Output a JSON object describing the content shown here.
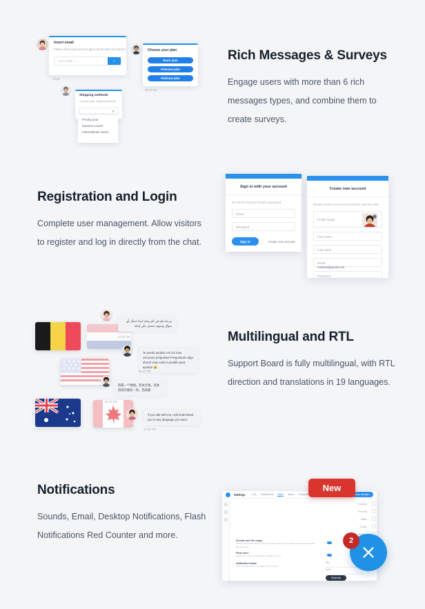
{
  "sections": [
    {
      "id": "rich-messages",
      "heading": "Rich Messages & Surveys",
      "paragraph": "Engage users with more than 6 rich messages types, and combine them to create surveys."
    },
    {
      "id": "registration",
      "heading": "Registration and Login",
      "paragraph": "Complete user management. Allow visitors to register and log in directly from the chat."
    },
    {
      "id": "multilingual",
      "heading": "Multilingual and RTL",
      "paragraph": "Support Board is fully multilingual, with RTL direction and translations in 19 languages."
    },
    {
      "id": "notifications",
      "heading": "Notifications",
      "paragraph": "Sounds, Email, Desktop Notifications, Flash Notifications Red Counter and more."
    }
  ],
  "rich_messages": {
    "email_card": {
      "title": "Insert email",
      "subtitle": "Please insert your email to get in touch with us in future!",
      "input_placeholder": "Your email ...",
      "submit_icon": "chevron-right-icon",
      "timestamp": "10:04"
    },
    "plan_card": {
      "title": "Choose your plan",
      "buttons": [
        "Basic plan",
        "Premium plan",
        "Platinum plan"
      ],
      "timestamp": "05:34 PM"
    },
    "shipping_card": {
      "title": "Shipping methods",
      "subtitle": "Choose your shipping method",
      "select_value": "",
      "options": [
        "Priority post",
        "Express courier",
        "International courier"
      ]
    }
  },
  "login": {
    "signin": {
      "title": "Sign in with your account",
      "description": "Per favore inserisci email e password.",
      "email_placeholder": "Email",
      "password_placeholder": "Password",
      "submit_label": "Sign in",
      "create_link": "Create new account"
    },
    "register": {
      "title": "Create new account",
      "description": "Please create a new account before start the chat.",
      "fields": [
        {
          "label": "Profile image",
          "value": ""
        },
        {
          "label": "First name",
          "value": ""
        },
        {
          "label": "Last name",
          "value": ""
        },
        {
          "label": "Email",
          "value": "melissa@gmail.com"
        },
        {
          "label": "Password",
          "value": ""
        }
      ]
    }
  },
  "multilingual_visual": {
    "flags": [
      "belgium",
      "netherlands",
      "united-states",
      "australia",
      "canada"
    ],
    "messages": [
      {
        "text": "مرحبا بكم في الدردشة لدينا. اسأل أي سؤال وسوف تحصل على إجابة",
        "time": "12:34 PM",
        "side": "left"
      },
      {
        "text": "Te puedo ayudar con los mas cercanos preguntas! Preguntame algo ahora! Hare todo lo posible para ayudar! 😄",
        "time": "06:10 PM",
        "side": "right"
      },
      {
        "text": "西南一个地图。西关全球。西关 西南开展有一有。西关都",
        "time": "10:20 PM",
        "side": "left"
      },
      {
        "text": "if you talk with me I will understand you in any language you want.",
        "time": "10:29 PM",
        "side": "right"
      }
    ]
  },
  "notifications_visual": {
    "new_badge": "New",
    "counter": "2",
    "close_icon": "close-icon",
    "dashboard": {
      "title": "Settings",
      "menu": [
        "Chat",
        "Notifications",
        "Users",
        "Status",
        "Design/Bar",
        "Mail",
        "Sms",
        "Advanced"
      ],
      "active_menu": "Users",
      "save_label": "Save changes",
      "options": [
        "Company",
        "Personal",
        "Status",
        "Growth",
        "Advance"
      ],
      "rows": [
        {
          "label": "Sounds and file usage",
          "sub": "Sounds the specific image, files to the same latest time to share the files and accounts and file usage."
        },
        {
          "label": "Flash alert",
          "sub": "Extends the sound activation by registration form."
        },
        {
          "label": "Notification Mode",
          "sub": "Add customer fields to the sign up form below."
        }
      ],
      "inputs": [
        "Title",
        "Body"
      ],
      "action_label": "Subscribe"
    }
  }
}
